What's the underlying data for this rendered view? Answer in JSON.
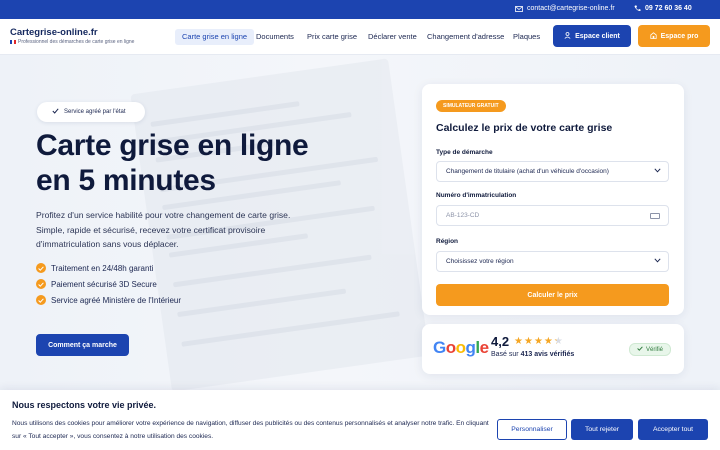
{
  "topbar": {
    "email": "contact@cartegrise-online.fr",
    "phone": "09 72 60 36 40",
    "icons": {
      "email": "mail-icon",
      "phone": "phone-icon"
    }
  },
  "brand": {
    "name": "Cartegrise-online.fr",
    "tagline": "Professionnel des démarches de carte grise en ligne"
  },
  "nav": {
    "items": [
      {
        "label": "Carte grise en ligne",
        "active": true
      },
      {
        "label": "Documents"
      },
      {
        "label": "Prix carte grise"
      },
      {
        "label": "Déclarer vente"
      },
      {
        "label": "Changement d'adresse"
      },
      {
        "label": "Plaques"
      }
    ],
    "client_button": "Espace client",
    "pro_button": "Espace pro"
  },
  "hero": {
    "badge": "Service agréé par l'état",
    "title_line1": "Carte grise en ligne",
    "title_line2": "en 5 minutes",
    "intro": "Profitez d'un service habilité pour votre changement de carte grise. Simple, rapide et sécurisé, recevez votre certificat provisoire d'immatriculation sans vous déplacer.",
    "features": [
      "Traitement en 24/48h garanti",
      "Paiement sécurisé 3D Secure",
      "Service agréé Ministère de l'Intérieur"
    ],
    "cta": "Comment ça marche"
  },
  "simulator": {
    "badge": "SIMULATEUR GRATUIT",
    "title": "Calculez le prix de votre carte grise",
    "demarche_label": "Type de démarche",
    "demarche_value": "Changement de titulaire (achat d'un véhicule d'occasion)",
    "immat_label": "Numéro d'immatriculation",
    "immat_placeholder": "AB-123-CD",
    "region_label": "Région",
    "region_value": "Choisissez votre région",
    "submit": "Calculer le prix"
  },
  "reviews": {
    "logo": "Google",
    "rating": "4,2",
    "stars": 4.2,
    "based_prefix": "Basé sur",
    "count": "413 avis vérifiés",
    "verified": "Vérifié"
  },
  "cookie": {
    "title": "Nous respectons votre vie privée.",
    "text": "Nous utilisons des cookies pour améliorer votre expérience de navigation, diffuser des publicités ou des contenus personnalisés et analyser notre trafic. En cliquant sur « Tout accepter », vous consentez à notre utilisation des cookies.",
    "customize": "Personnaliser",
    "reject": "Tout rejeter",
    "accept": "Accepter tout"
  },
  "colors": {
    "primary": "#1c44b0",
    "accent": "#f59a1e",
    "text": "#0f1a3c"
  }
}
